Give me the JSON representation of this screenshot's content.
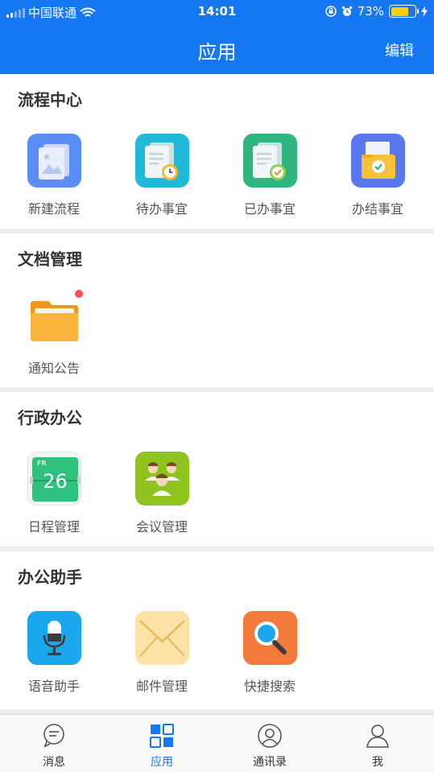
{
  "status": {
    "carrier": "中国联通",
    "time": "14:01",
    "battery": "73%",
    "battery_level": 0.73
  },
  "header": {
    "title": "应用",
    "edit": "编辑"
  },
  "sections": [
    {
      "title": "流程中心",
      "apps": [
        {
          "label": "新建流程",
          "icon": "new-process-icon"
        },
        {
          "label": "待办事宜",
          "icon": "pending-tasks-icon"
        },
        {
          "label": "已办事宜",
          "icon": "done-tasks-icon"
        },
        {
          "label": "办结事宜",
          "icon": "completed-matters-icon"
        }
      ]
    },
    {
      "title": "文档管理",
      "apps": [
        {
          "label": "通知公告",
          "icon": "folder-icon"
        }
      ]
    },
    {
      "title": "行政办公",
      "apps": [
        {
          "label": "日程管理",
          "icon": "calendar-icon",
          "calendar_day": "FR",
          "calendar_date": "26"
        },
        {
          "label": "会议管理",
          "icon": "meeting-icon"
        }
      ]
    },
    {
      "title": "办公助手",
      "apps": [
        {
          "label": "语音助手",
          "icon": "microphone-icon"
        },
        {
          "label": "邮件管理",
          "icon": "mail-icon"
        },
        {
          "label": "快捷搜索",
          "icon": "search-icon"
        }
      ]
    }
  ],
  "tabs": [
    {
      "label": "消息",
      "icon": "message-icon"
    },
    {
      "label": "应用",
      "icon": "apps-icon",
      "active": true
    },
    {
      "label": "通讯录",
      "icon": "contacts-icon"
    },
    {
      "label": "我",
      "icon": "profile-icon"
    }
  ],
  "colors": {
    "brand": "#1677f2",
    "badge": "#ff4f4f"
  }
}
